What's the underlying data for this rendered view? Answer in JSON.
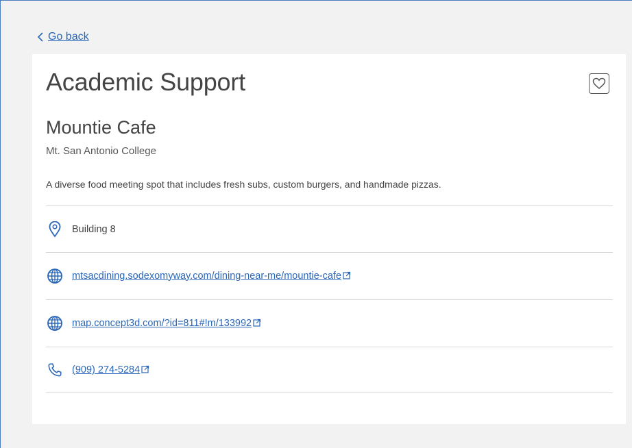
{
  "nav": {
    "back_label": "Go back"
  },
  "card": {
    "category": "Academic Support",
    "name": "Mountie Cafe",
    "organization": "Mt. San Antonio College",
    "description": "A diverse food meeting spot that includes fresh subs, custom burgers, and handmade pizzas.",
    "location": "Building 8",
    "website_1": "mtsacdining.sodexomyway.com/dining-near-me/mountie-cafe",
    "website_2": "map.concept3d.com/?id=811#!m/133992",
    "phone": "(909) 274-5284"
  },
  "colors": {
    "link": "#2a66b8",
    "divider": "#d6d6d6",
    "background": "#f2f2f2"
  },
  "icons": [
    "chevron-left-icon",
    "heart-icon",
    "map-pin-icon",
    "globe-icon",
    "phone-icon",
    "external-link-icon"
  ]
}
